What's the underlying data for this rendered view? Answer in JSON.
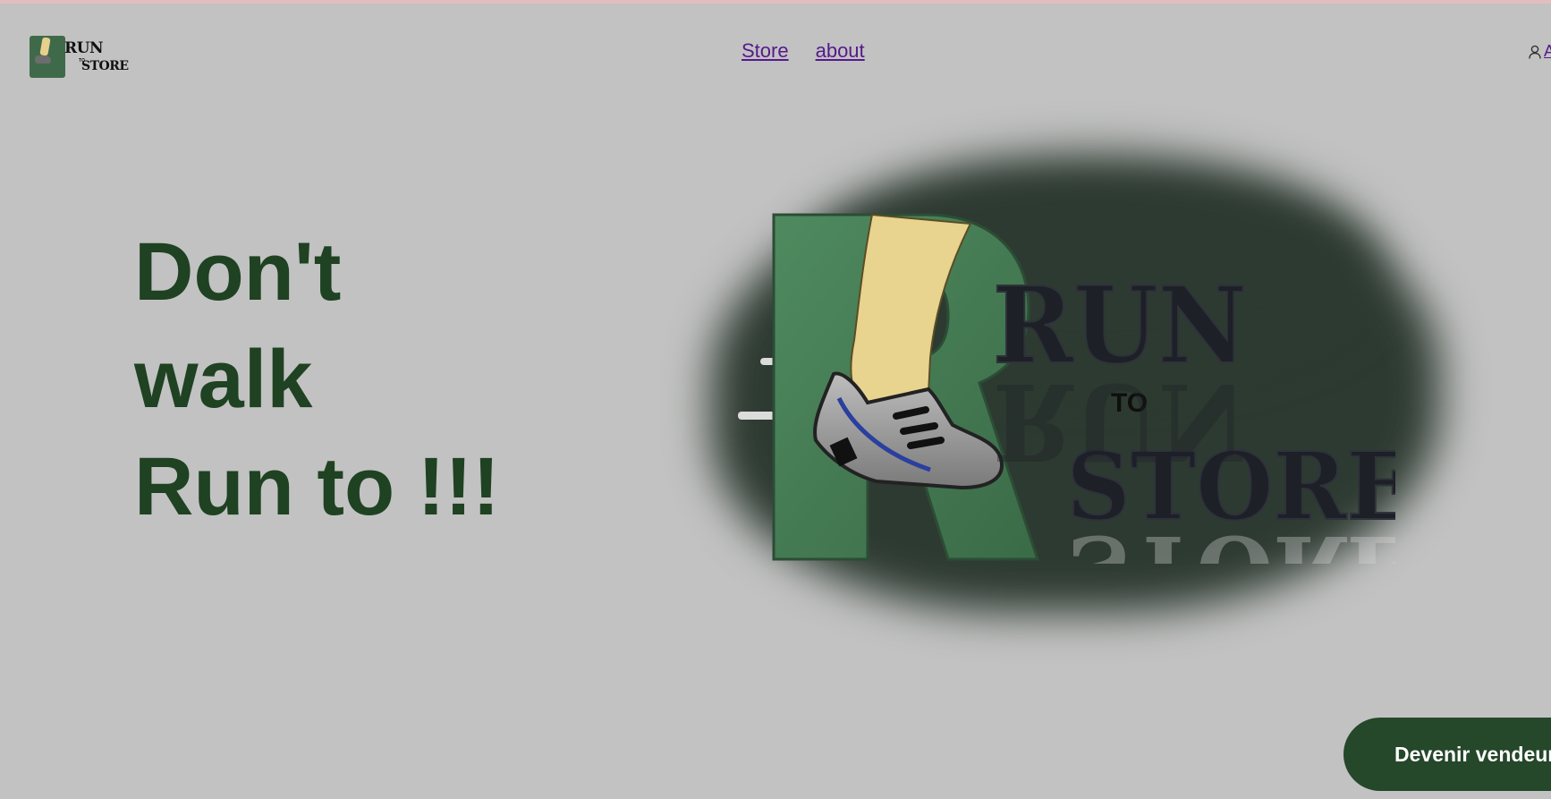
{
  "header": {
    "logo": {
      "line1": "RUN",
      "line2": "TO",
      "line3": "STORE"
    },
    "nav": [
      {
        "label": "Store"
      },
      {
        "label": "about"
      }
    ],
    "account_icon": "user-icon",
    "account_label": "A"
  },
  "hero": {
    "title_lines": [
      "Don't",
      "walk",
      "Run to !!!"
    ],
    "title_color": "#1f4222"
  },
  "big_logo": {
    "word1": "RUN",
    "word2": "TO",
    "word3": "STORE"
  },
  "cta": {
    "label": "Devenir vendeur"
  },
  "colors": {
    "background": "#c2c2c2",
    "brand_green": "#3f6a4a",
    "dark_green": "#25472a",
    "link": "#551a8b"
  }
}
